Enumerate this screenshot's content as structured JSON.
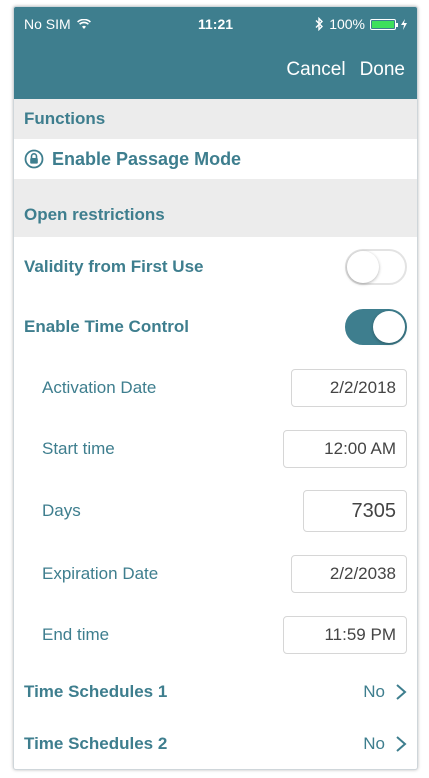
{
  "status_bar": {
    "carrier": "No SIM",
    "time": "11:21",
    "battery_percent": "100%",
    "icons": [
      "wifi-icon",
      "bluetooth-icon",
      "battery-icon",
      "charging-icon"
    ]
  },
  "navbar": {
    "cancel_label": "Cancel",
    "done_label": "Done"
  },
  "functions": {
    "header": "Functions",
    "passage_mode_label": "Enable Passage Mode"
  },
  "open_restrictions": {
    "header": "Open restrictions",
    "validity_label": "Validity from First Use",
    "validity_on": false,
    "time_control_label": "Enable Time Control",
    "time_control_on": true,
    "activation_date_label": "Activation Date",
    "activation_date_value": "2/2/2018",
    "start_time_label": "Start time",
    "start_time_value": "12:00 AM",
    "days_label": "Days",
    "days_value": "7305",
    "expiration_date_label": "Expiration Date",
    "expiration_date_value": "2/2/2038",
    "end_time_label": "End time",
    "end_time_value": "11:59 PM",
    "schedule1_label": "Time Schedules 1",
    "schedule1_value": "No",
    "schedule2_label": "Time Schedules 2",
    "schedule2_value": "No"
  },
  "colors": {
    "accent": "#3e7e8e",
    "section_bg": "#ececec",
    "battery_green": "#3ee05c"
  }
}
